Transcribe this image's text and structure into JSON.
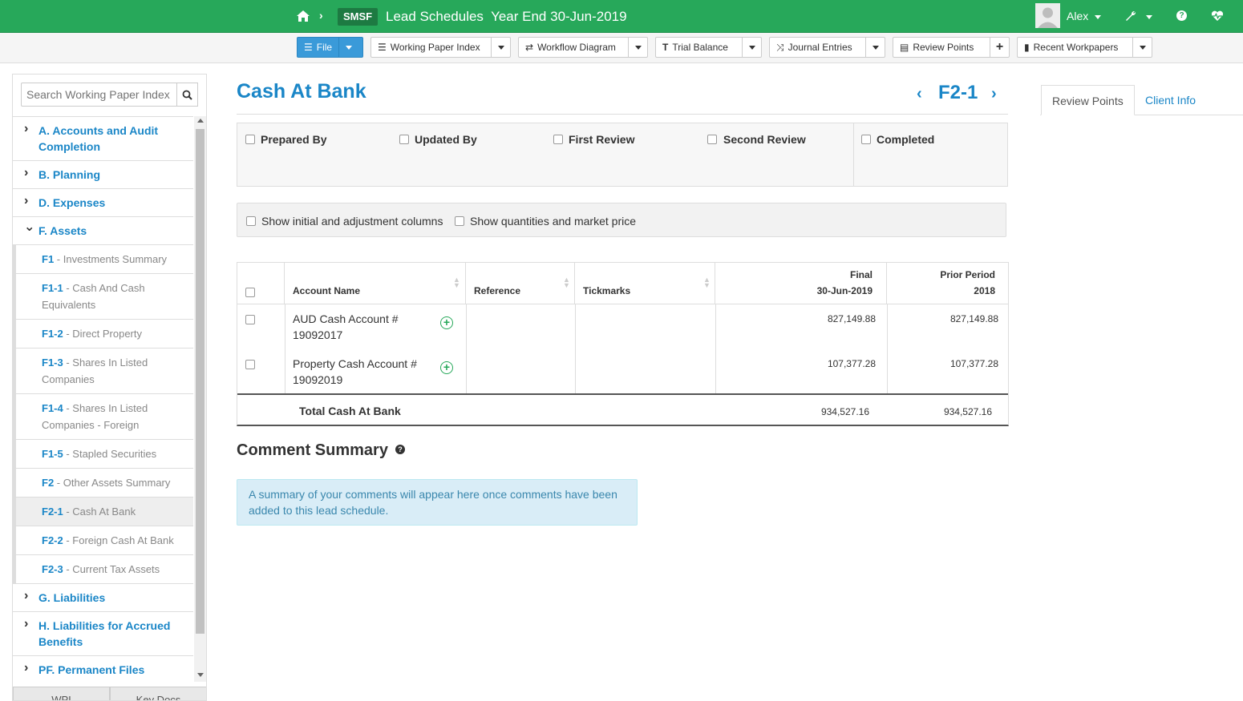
{
  "topbar": {
    "badge": "SMSF",
    "title": "Lead Schedules  Year End 30-Jun-2019",
    "user_name": "Alex",
    "help_glyph": "?",
    "icons": [
      "home-icon",
      "user-avatar",
      "wrench-icon",
      "help-icon",
      "heart-monitor-icon"
    ]
  },
  "toolbar": {
    "file": "File",
    "working_paper_index": "Working Paper Index",
    "workflow_diagram": "Workflow Diagram",
    "trial_balance": "Trial Balance",
    "journal_entries": "Journal Entries",
    "review_points": "Review Points",
    "recent_workpapers": "Recent Workpapers"
  },
  "sidebar": {
    "search_placeholder": "Search Working Paper Index",
    "items": [
      {
        "type": "top",
        "label": "A. Accounts and Audit Completion",
        "expanded": false
      },
      {
        "type": "top",
        "label": "B. Planning",
        "expanded": false
      },
      {
        "type": "top",
        "label": "D. Expenses",
        "expanded": false
      },
      {
        "type": "top",
        "label": "F. Assets",
        "expanded": true
      },
      {
        "type": "sub",
        "code": "F1",
        "label": "Investments Summary"
      },
      {
        "type": "sub",
        "code": "F1-1",
        "label": "Cash And Cash Equivalents"
      },
      {
        "type": "sub",
        "code": "F1-2",
        "label": "Direct Property"
      },
      {
        "type": "sub",
        "code": "F1-3",
        "label": "Shares In Listed Companies"
      },
      {
        "type": "sub",
        "code": "F1-4",
        "label": "Shares In Listed Companies - Foreign"
      },
      {
        "type": "sub",
        "code": "F1-5",
        "label": "Stapled Securities"
      },
      {
        "type": "sub",
        "code": "F2",
        "label": "Other Assets Summary"
      },
      {
        "type": "sub",
        "code": "F2-1",
        "label": "Cash At Bank",
        "active": true
      },
      {
        "type": "sub",
        "code": "F2-2",
        "label": "Foreign Cash At Bank"
      },
      {
        "type": "sub",
        "code": "F2-3",
        "label": "Current Tax Assets"
      },
      {
        "type": "top",
        "label": "G. Liabilities",
        "expanded": false
      },
      {
        "type": "top",
        "label": "H. Liabilities for Accrued Benefits",
        "expanded": false
      },
      {
        "type": "top",
        "label": "PF. Permanent Files",
        "expanded": false
      }
    ],
    "tabs": [
      "WPI",
      "Key Docs"
    ]
  },
  "main": {
    "title": "Cash At Bank",
    "ref_code": "F2-1",
    "signoffs": [
      "Prepared By",
      "Updated By",
      "First Review",
      "Second Review",
      "Completed"
    ],
    "options": [
      "Show initial and adjustment columns",
      "Show quantities and market price"
    ],
    "table": {
      "headers": {
        "account_name": "Account Name",
        "reference": "Reference",
        "tickmarks": "Tickmarks",
        "final_line1": "Final",
        "final_line2": "30-Jun-2019",
        "prior_line1": "Prior Period",
        "prior_line2": "2018"
      },
      "rows": [
        {
          "account": "AUD Cash Account # 19092017",
          "final": "827,149.88",
          "prior": "827,149.88"
        },
        {
          "account": "Property Cash Account # 19092019",
          "final": "107,377.28",
          "prior": "107,377.28"
        }
      ],
      "total_label": "Total Cash At Bank",
      "total_final": "934,527.16",
      "total_prior": "934,527.16"
    },
    "comment_title": "Comment Summary",
    "comment_help": "?",
    "comment_info": "A summary of your comments will appear here once comments have been added to this lead schedule."
  },
  "right_panel": {
    "tabs": [
      "Review Points",
      "Client Info"
    ],
    "active_tab": "Review Points"
  }
}
